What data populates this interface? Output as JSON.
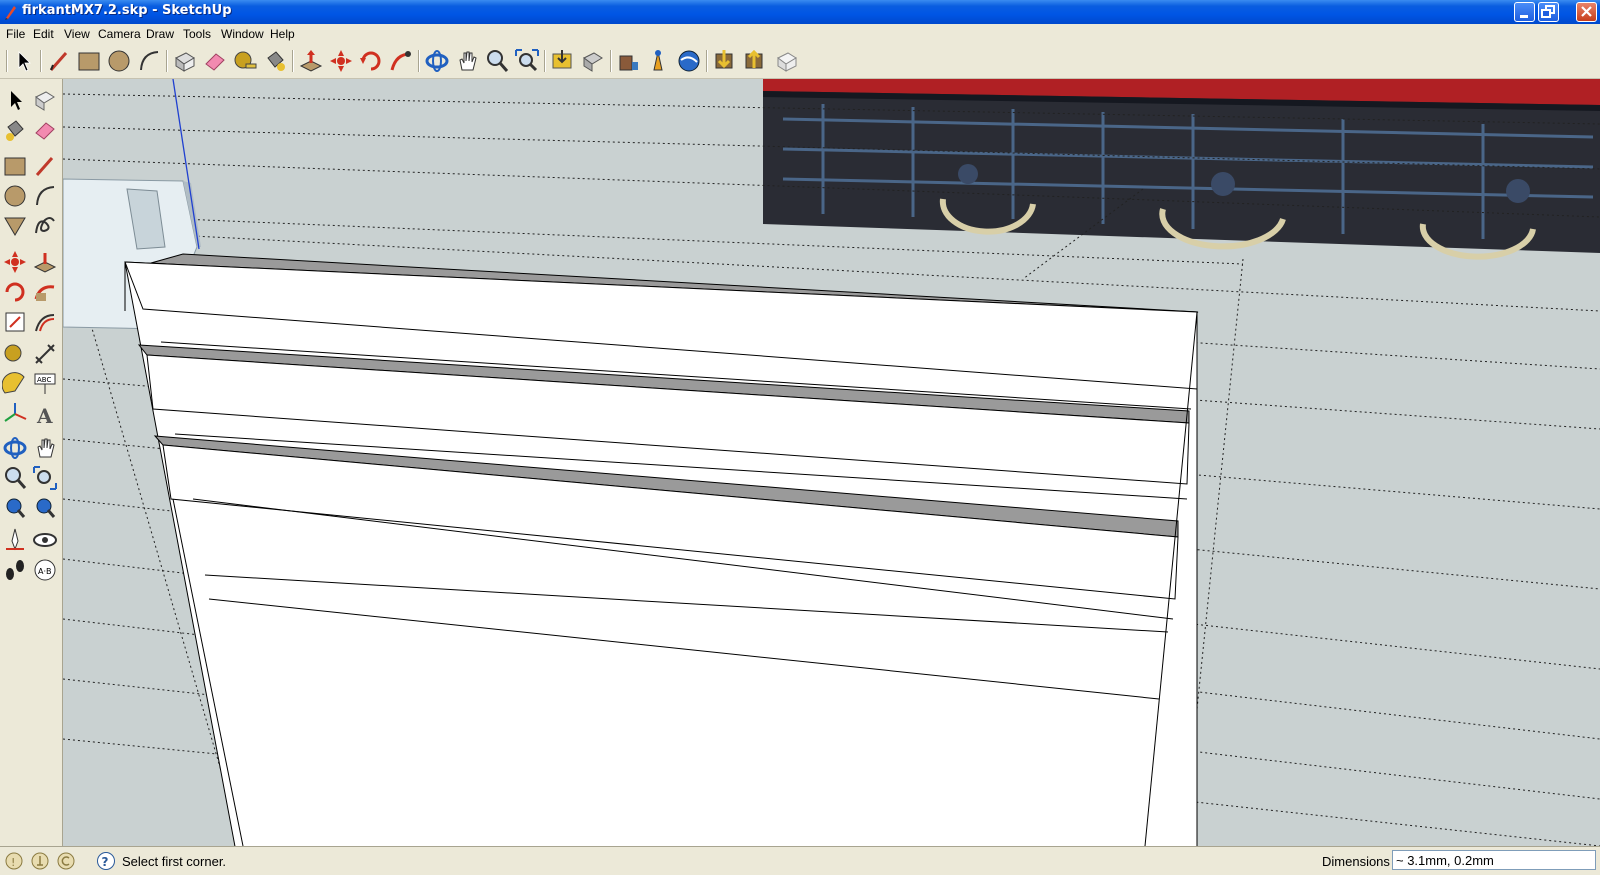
{
  "window": {
    "title": "firkantMX7.2.skp - SketchUp",
    "minimize_label": "minimize",
    "maximize_label": "restore",
    "close_label": "close"
  },
  "menu": {
    "file": "File",
    "edit": "Edit",
    "view": "View",
    "camera": "Camera",
    "draw": "Draw",
    "tools": "Tools",
    "window": "Window",
    "help": "Help"
  },
  "toolbar_icons": [
    "select-icon",
    "line-icon",
    "rectangle-icon",
    "circle-icon",
    "arc-icon",
    "make-component-icon",
    "eraser-icon",
    "tape-measure-icon",
    "paint-bucket-icon",
    "push-pull-icon",
    "move-icon",
    "rotate-icon",
    "follow-me-icon",
    "orbit-icon",
    "pan-icon",
    "zoom-icon",
    "zoom-extents-icon",
    "get-models-icon",
    "share-model-icon",
    "add-location-icon",
    "toggle-terrain-icon",
    "google-earth-icon",
    "get-component-icon",
    "share-component-icon",
    "send-to-layout-icon"
  ],
  "status": {
    "hint": "Select first corner.",
    "dimensions_label": "Dimensions",
    "dimensions_value": "~ 3.1mm, 0.2mm"
  },
  "colors": {
    "titlebar": "#0055e5",
    "chrome": "#ece9d8",
    "sky": "#c8d0d0",
    "model_face": "#ffffff",
    "model_top": "#9a9a9a"
  }
}
